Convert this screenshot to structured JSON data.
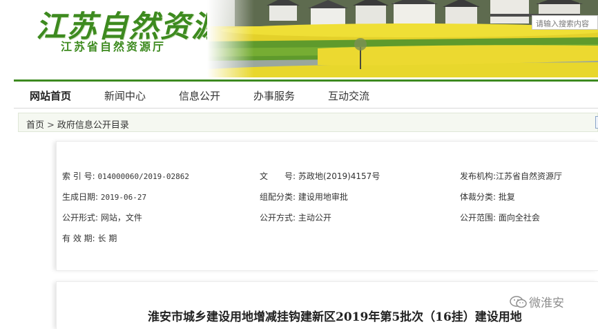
{
  "header": {
    "logo_main": "江苏自然资源",
    "logo_sub": "江苏省自然资源厅",
    "search_placeholder": "请输入搜索内容"
  },
  "nav": {
    "items": [
      "网站首页",
      "新闻中心",
      "信息公开",
      "办事服务",
      "互动交流"
    ]
  },
  "breadcrumb": {
    "home": "首页",
    "separator": ">",
    "current": "政府信息公开目录"
  },
  "meta": {
    "index_label": "索 引 号:",
    "index_value": "014000060/2019-02862",
    "doc_label": "文　　号:",
    "doc_value": "苏政地(2019)4157号",
    "publisher_label": "发布机构:",
    "publisher_value": "江苏省自然资源厅",
    "date_label": "生成日期:",
    "date_value": "2019-06-27",
    "category_label": "组配分类:",
    "category_value": "建设用地审批",
    "genre_label": "体裁分类:",
    "genre_value": "批复",
    "form_label": "公开形式:",
    "form_value": "网站，文件",
    "method_label": "公开方式:",
    "method_value": "主动公开",
    "scope_label": "公开范围:",
    "scope_value": "面向全社会",
    "validity_label": "有 效 期:",
    "validity_value": "长 期"
  },
  "article": {
    "title": "淮安市城乡建设用地增减挂钩建新区2019年第5批次（16挂）建设用地"
  },
  "watermark": {
    "text": "微淮安"
  },
  "colors": {
    "brand_green": "#3d8a1f",
    "breadcrumb_bg": "#f5f8f1"
  }
}
